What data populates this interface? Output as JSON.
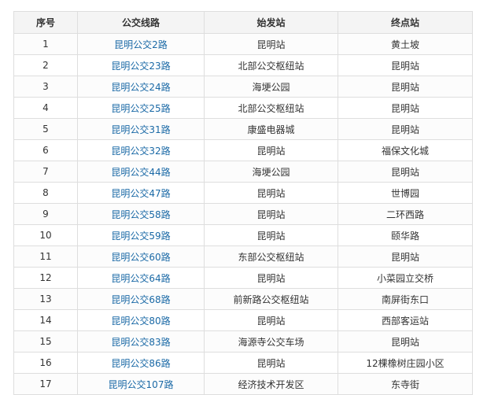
{
  "headers": [
    "序号",
    "公交线路",
    "始发站",
    "终点站"
  ],
  "rows": [
    {
      "idx": "1",
      "route": "昆明公交2路",
      "start": "昆明站",
      "end": "黄土坡"
    },
    {
      "idx": "2",
      "route": "昆明公交23路",
      "start": "北部公交枢纽站",
      "end": "昆明站"
    },
    {
      "idx": "3",
      "route": "昆明公交24路",
      "start": "海埂公园",
      "end": "昆明站"
    },
    {
      "idx": "4",
      "route": "昆明公交25路",
      "start": "北部公交枢纽站",
      "end": "昆明站"
    },
    {
      "idx": "5",
      "route": "昆明公交31路",
      "start": "康盛电器城",
      "end": "昆明站"
    },
    {
      "idx": "6",
      "route": "昆明公交32路",
      "start": "昆明站",
      "end": "福保文化城"
    },
    {
      "idx": "7",
      "route": "昆明公交44路",
      "start": "海埂公园",
      "end": "昆明站"
    },
    {
      "idx": "8",
      "route": "昆明公交47路",
      "start": "昆明站",
      "end": "世博园"
    },
    {
      "idx": "9",
      "route": "昆明公交58路",
      "start": "昆明站",
      "end": "二环西路"
    },
    {
      "idx": "10",
      "route": "昆明公交59路",
      "start": "昆明站",
      "end": "颐华路"
    },
    {
      "idx": "11",
      "route": "昆明公交60路",
      "start": "东部公交枢纽站",
      "end": "昆明站"
    },
    {
      "idx": "12",
      "route": "昆明公交64路",
      "start": "昆明站",
      "end": "小菜园立交桥"
    },
    {
      "idx": "13",
      "route": "昆明公交68路",
      "start": "前新路公交枢纽站",
      "end": "南屏街东口"
    },
    {
      "idx": "14",
      "route": "昆明公交80路",
      "start": "昆明站",
      "end": "西部客运站"
    },
    {
      "idx": "15",
      "route": "昆明公交83路",
      "start": "海源寺公交车场",
      "end": "昆明站"
    },
    {
      "idx": "16",
      "route": "昆明公交86路",
      "start": "昆明站",
      "end": "12棵橡树庄园小区"
    },
    {
      "idx": "17",
      "route": "昆明公交107路",
      "start": "经济技术开发区",
      "end": "东寺街"
    }
  ],
  "colors": {
    "link": "#1a69a6",
    "border": "#dedede",
    "header_bg": "#f4f4f4",
    "text": "#333333"
  }
}
